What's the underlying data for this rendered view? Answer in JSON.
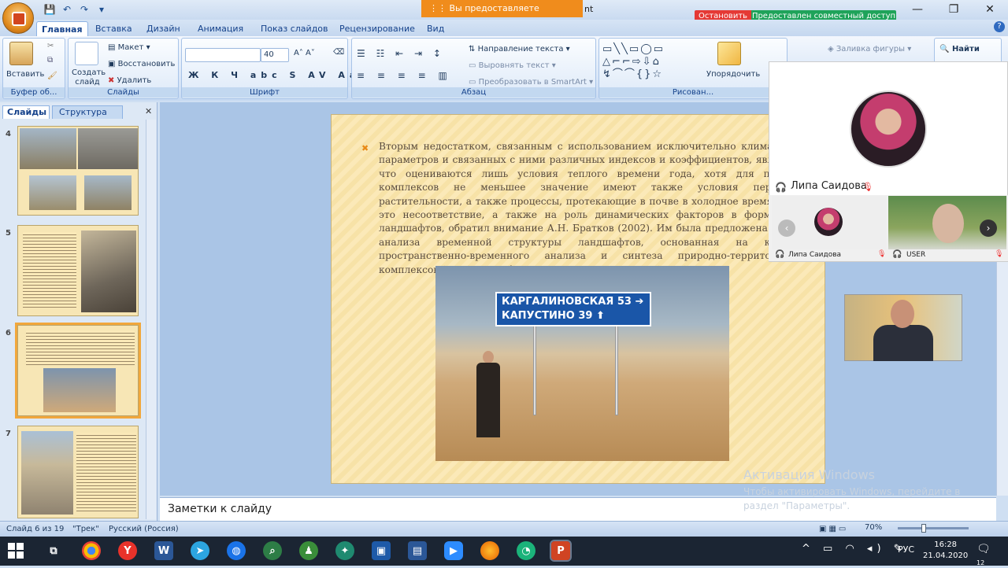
{
  "window": {
    "share_banner": "⋮⋮ Вы предоставляете совместный д...",
    "title_tail": "nt",
    "stop_label": "Остановить",
    "shared_label": "Предоставлен совместный доступ"
  },
  "tabs": [
    "Главная",
    "Вставка",
    "Дизайн",
    "Анимация",
    "Показ слайдов",
    "Рецензирование",
    "Вид"
  ],
  "ribbon": {
    "clipboard": {
      "paste": "Вставить",
      "label": "Буфер об..."
    },
    "slides": {
      "create": "Создать слайд",
      "layout": "Макет",
      "restore": "Восстановить",
      "delete": "Удалить",
      "label": "Слайды"
    },
    "font": {
      "size": "40",
      "label": "Шрифт"
    },
    "paragraph": {
      "text_direction": "Направление текста",
      "align_text": "Выровнять текст",
      "smartart": "Преобразовать в SmartArt",
      "label": "Абзац"
    },
    "drawing": {
      "arrange": "Упорядочить",
      "fill": "Заливка фигуры",
      "label": "Рисован..."
    },
    "editing": {
      "find": "Найти"
    }
  },
  "left_panel": {
    "tab_slides": "Слайды",
    "tab_outline": "Структура",
    "thumbs": [
      "4",
      "5",
      "6",
      "7"
    ]
  },
  "slide": {
    "text": "Вторым недостатком, связанным с использованием исключительно климатических параметров и связанных с ними различных индексов и коэффициентов, является то, что оцениваются лишь условия теплого времени года, хотя для природных комплексов не меньшее значение имеют также условия перезимовки растительности, а также процессы, протекающие в почве в холодное время года. На это несоответствие, а также на роль динамических факторов в формировании ландшафтов, обратил внимание А.Н. Братков (2002). Им была предложена методика анализа временной структуры ландшафтов, основанная на концепции пространственно-временного анализа и синтеза природно-территориальных комплексов (ПТК), разработанной Н.Л. Беручашвили (1985).",
    "sign_line1": "КАРГАЛИНОВСКАЯ 53 ➔",
    "sign_line2": "КАПУСТИНО       39 ⬆"
  },
  "notes_placeholder": "Заметки к слайду",
  "activation": {
    "title": "Активация Windows",
    "body": "Чтобы активировать Windows, перейдите в раздел \"Параметры\"."
  },
  "status": {
    "slide": "Слайд 6 из 19",
    "theme": "\"Трек\"",
    "lang": "Русский (Россия)",
    "zoom": "70%"
  },
  "video": {
    "name_main": "Липа Саидова",
    "tile1": "Липа Саидова",
    "tile2": "USER"
  },
  "taskbar": {
    "lang": "РУС",
    "time": "16:28",
    "date": "21.04.2020",
    "notif_count": "12"
  }
}
